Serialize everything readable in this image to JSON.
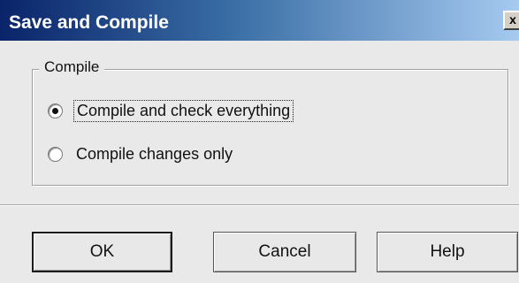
{
  "window": {
    "title": "Save and Compile",
    "close_label": "x"
  },
  "group": {
    "label": "Compile"
  },
  "options": [
    {
      "label": "Compile and check everything",
      "selected": true
    },
    {
      "label": "Compile changes only",
      "selected": false
    }
  ],
  "buttons": {
    "ok": "OK",
    "cancel": "Cancel",
    "help": "Help"
  },
  "colors": {
    "title_bar_start": "#0a246a",
    "title_bar_end": "#a6caf0",
    "dialog_background": "#e9e9e9"
  }
}
